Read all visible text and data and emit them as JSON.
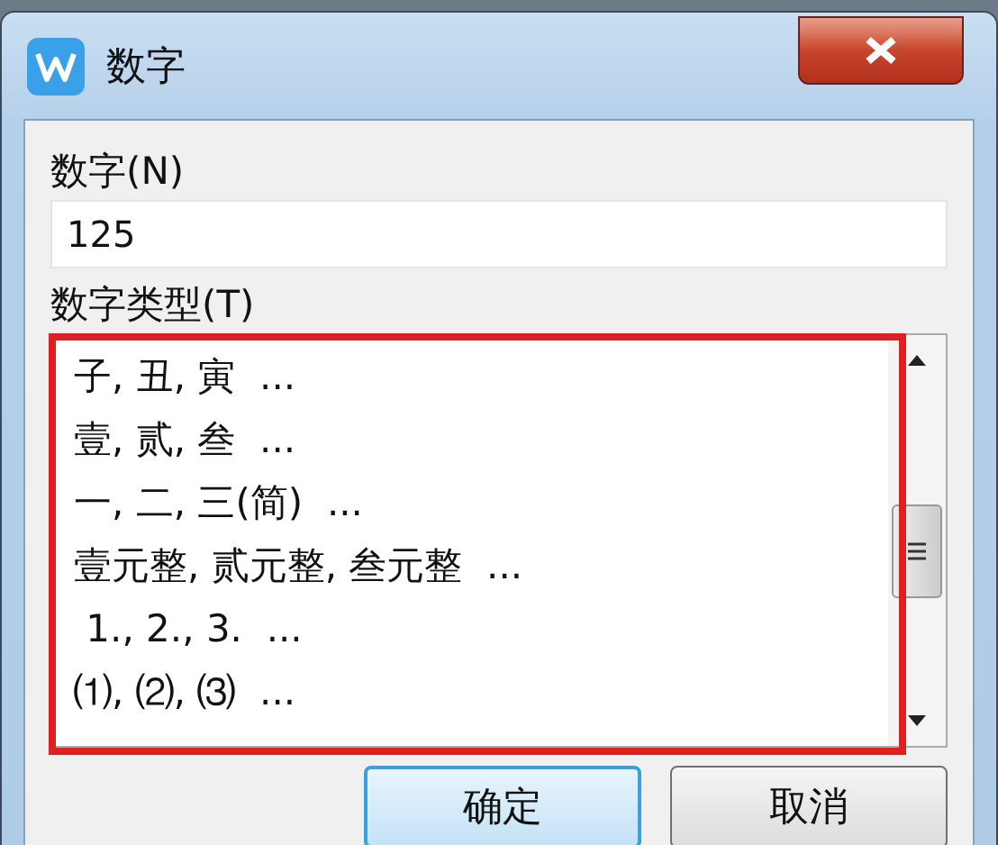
{
  "window": {
    "title": "数字"
  },
  "number_field": {
    "label": "数字(N)",
    "value": "125"
  },
  "type_list": {
    "label": "数字类型(T)",
    "items": [
      {
        "text": "子, 丑, 寅  ...",
        "selected": false
      },
      {
        "text": "壹, 贰, 叁  ...",
        "selected": false
      },
      {
        "text": "一, 二, 三(简)  ...",
        "selected": false
      },
      {
        "text": "壹元整, 贰元整, 叁元整  ...",
        "selected": false
      },
      {
        "text": " 1., 2., 3.  ...",
        "selected": false
      },
      {
        "text": "⑴, ⑵, ⑶  ...",
        "selected": false
      }
    ]
  },
  "buttons": [
    {
      "label": "确定",
      "default": true
    },
    {
      "label": "取消",
      "default": false
    }
  ]
}
